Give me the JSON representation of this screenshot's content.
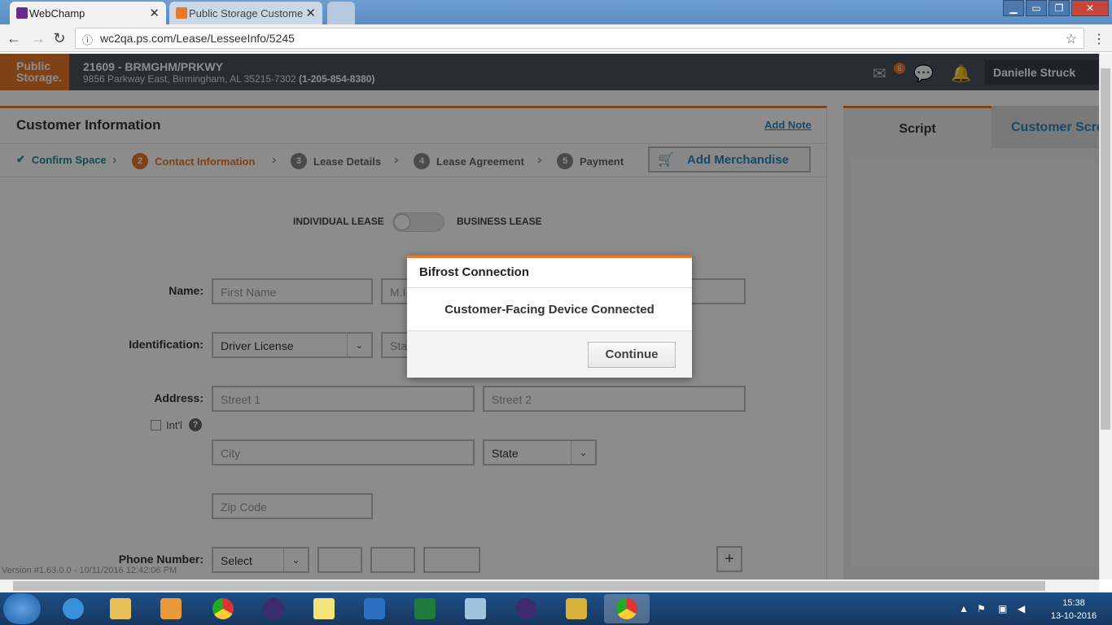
{
  "browser": {
    "tabs": [
      {
        "title": "WebChamp",
        "active": true
      },
      {
        "title": "Public Storage Customer",
        "active": false
      }
    ],
    "url": "wc2qa.ps.com/Lease/LesseeInfo/5245"
  },
  "header": {
    "logo_line1": "Public",
    "logo_line2": "Storage.",
    "store_name": "21609 - BRMGHM/PRKWY",
    "store_address": "9856 Parkway East, Birmingham, AL 35215-7302",
    "store_phone": "(1-205-854-8380)",
    "mail_count": "6",
    "user_name": "Danielle Struck"
  },
  "main": {
    "title": "Customer Information",
    "add_note": "Add Note",
    "steps": [
      {
        "num": "",
        "label": "Confirm Space",
        "state": "done"
      },
      {
        "num": "2",
        "label": "Contact Information",
        "state": "current"
      },
      {
        "num": "3",
        "label": "Lease Details",
        "state": "pending"
      },
      {
        "num": "4",
        "label": "Lease Agreement",
        "state": "pending"
      },
      {
        "num": "5",
        "label": "Payment",
        "state": "pending"
      }
    ],
    "add_merchandise": "Add Merchandise",
    "lease_toggle": {
      "left": "INDIVIDUAL LEASE",
      "right": "BUSINESS LEASE"
    },
    "form": {
      "name_label": "Name:",
      "first_name_placeholder": "First Name",
      "mi_placeholder": "M.I.",
      "identification_label": "Identification:",
      "id_type": "Driver License",
      "id_state_placeholder": "State",
      "address_label": "Address:",
      "street1_placeholder": "Street 1",
      "street2_placeholder": "Street 2",
      "intl_label": "Int'l",
      "city_placeholder": "City",
      "state_select": "State",
      "zip_placeholder": "Zip Code",
      "phone_label": "Phone Number:",
      "phone_type": "Select"
    },
    "version": "Version #1.63.0.0 - 10/11/2016 12:42:06 PM"
  },
  "right_panel": {
    "tab_script": "Script",
    "tab_customer_screen": "Customer Screen"
  },
  "modal": {
    "title": "Bifrost Connection",
    "message": "Customer-Facing Device Connected",
    "continue": "Continue"
  },
  "taskbar": {
    "time": "15:38",
    "date": "13-10-2016"
  },
  "colors": {
    "brand_orange": "#e8782a",
    "link_blue": "#2a86b8",
    "header_gray": "#4b535c"
  }
}
